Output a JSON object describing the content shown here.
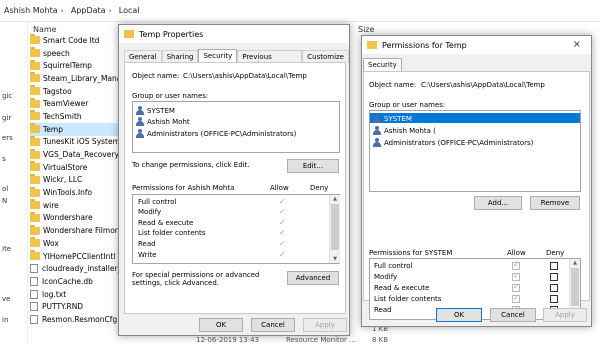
{
  "explorer": {
    "breadcrumb": [
      "Ashish Mohta",
      "AppData",
      "Local"
    ],
    "col_name": "Name",
    "col_size": "Size",
    "nav_labels": [
      "gic",
      "gir",
      "ers",
      "s",
      "ol",
      "N",
      "Ite",
      "ve",
      "in"
    ],
    "files": [
      {
        "name": "Smart Code ltd",
        "type": "folder"
      },
      {
        "name": "speech",
        "type": "folder"
      },
      {
        "name": "SquirrelTemp",
        "type": "folder"
      },
      {
        "name": "Steam_Library_Mana",
        "type": "folder"
      },
      {
        "name": "Tagstoo",
        "type": "folder"
      },
      {
        "name": "TeamViewer",
        "type": "folder"
      },
      {
        "name": "TechSmith",
        "type": "folder"
      },
      {
        "name": "Temp",
        "type": "folder",
        "selected": true
      },
      {
        "name": "TunesKit iOS System",
        "type": "folder"
      },
      {
        "name": "VGS_Data_Recovery",
        "type": "folder"
      },
      {
        "name": "VirtualStore",
        "type": "folder"
      },
      {
        "name": "Wickr, LLC",
        "type": "folder"
      },
      {
        "name": "WinTools.Info",
        "type": "folder"
      },
      {
        "name": "wire",
        "type": "folder"
      },
      {
        "name": "Wondershare",
        "type": "folder"
      },
      {
        "name": "Wondershare Filmora",
        "type": "folder"
      },
      {
        "name": "Wox",
        "type": "folder"
      },
      {
        "name": "YIHomePCClientIntl",
        "type": "folder"
      },
      {
        "name": "cloudready_installer_",
        "type": "file"
      },
      {
        "name": "IconCache.db",
        "type": "file"
      },
      {
        "name": "log.txt",
        "type": "file"
      },
      {
        "name": "PUTTY.RND",
        "type": "file"
      },
      {
        "name": "Resmon.ResmonCfg",
        "type": "file"
      }
    ],
    "bottom_date": "12-06-2019 13:43",
    "bottom_type": "Resource Monitor ...",
    "bottom_size": "8 KB",
    "size_1kb": "1 KB"
  },
  "props": {
    "title": "Temp Properties",
    "tabs": [
      "General",
      "Sharing",
      "Security",
      "Previous Versions",
      "Customize"
    ],
    "object_label": "Object name:",
    "object_value": "C:\\Users\\ashis\\AppData\\Local\\Temp",
    "group_label": "Group or user names:",
    "users": [
      "SYSTEM",
      "Ashish Moht",
      "Administrators (OFFICE-PC\\Administrators)"
    ],
    "change_text": "To change permissions, click Edit.",
    "edit_button": "Edit...",
    "perm_for": "Permissions for Ashish Mohta",
    "allow": "Allow",
    "deny": "Deny",
    "permissions": [
      "Full control",
      "Modify",
      "Read & execute",
      "List folder contents",
      "Read",
      "Write"
    ],
    "special_text": "For special permissions or advanced settings, click Advanced.",
    "advanced_button": "Advanced",
    "ok": "OK",
    "cancel": "Cancel",
    "apply": "Apply"
  },
  "perms": {
    "title": "Permissions for Temp",
    "close": "×",
    "tab": "Security",
    "object_label": "Object name:",
    "object_value": "C:\\Users\\ashis\\AppData\\Local\\Temp",
    "group_label": "Group or user names:",
    "users": [
      "SYSTEM",
      "Ashish Mohta (",
      "Administrators (OFFICE-PC\\Administrators)"
    ],
    "add_button": "Add...",
    "remove_button": "Remove",
    "perm_for": "Permissions for SYSTEM",
    "allow": "Allow",
    "deny": "Deny",
    "permissions": [
      "Full control",
      "Modify",
      "Read & execute",
      "List folder contents",
      "Read"
    ],
    "ok": "OK",
    "cancel": "Cancel",
    "apply": "Apply"
  },
  "colors": {
    "selection": "#0078d7",
    "folder": "#f0c44c",
    "explorer_selection": "#cce8ff"
  }
}
